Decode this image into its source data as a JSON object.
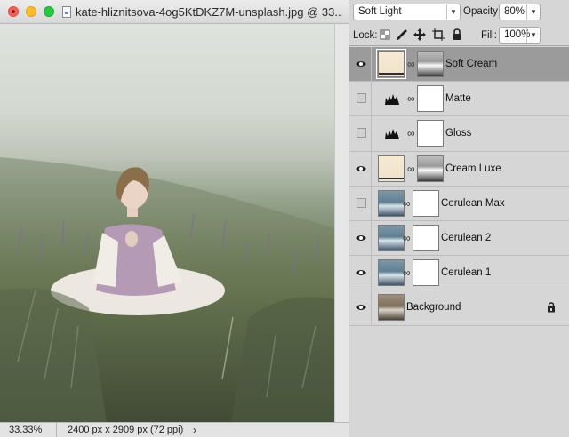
{
  "document": {
    "title": "kate-hliznitsova-4og5KtDKZ7M-unsplash.jpg @ 33...",
    "zoom": "33.33%",
    "size_info": "2400 px x 2909 px (72 ppi)",
    "status_arrow": "›"
  },
  "panel": {
    "blend_mode": "Soft Light",
    "opacity_label": "Opacity:",
    "opacity_value": "80%",
    "lock_label": "Lock:",
    "fill_label": "Fill:",
    "fill_value": "100%",
    "lock_icons": [
      "lock-transparent-icon",
      "lock-brush-icon",
      "lock-position-icon",
      "lock-artboard-icon",
      "lock-all-icon"
    ]
  },
  "layers": [
    {
      "name": "Soft Cream",
      "visible": true,
      "selected": true,
      "thumb": "cream",
      "mask": "bw"
    },
    {
      "name": "Matte",
      "visible": false,
      "selected": false,
      "thumb": "levels",
      "mask": "white"
    },
    {
      "name": "Gloss",
      "visible": false,
      "selected": false,
      "thumb": "levels",
      "mask": "white"
    },
    {
      "name": "Cream Luxe",
      "visible": true,
      "selected": false,
      "thumb": "cream",
      "mask": "bw"
    },
    {
      "name": "Cerulean Max",
      "visible": false,
      "selected": false,
      "thumb": "photo",
      "mask": "white"
    },
    {
      "name": "Cerulean 2",
      "visible": true,
      "selected": false,
      "thumb": "photo",
      "mask": "white"
    },
    {
      "name": "Cerulean 1",
      "visible": true,
      "selected": false,
      "thumb": "photo",
      "mask": "white"
    },
    {
      "name": "Background",
      "visible": true,
      "selected": false,
      "thumb": "bg",
      "locked": true
    }
  ],
  "colors": {
    "selected_row": "#9b9b9b",
    "panel_bg": "#d6d6d6",
    "close": "#fc5f57",
    "minimize": "#fdbc2e",
    "maximize": "#28c840"
  }
}
